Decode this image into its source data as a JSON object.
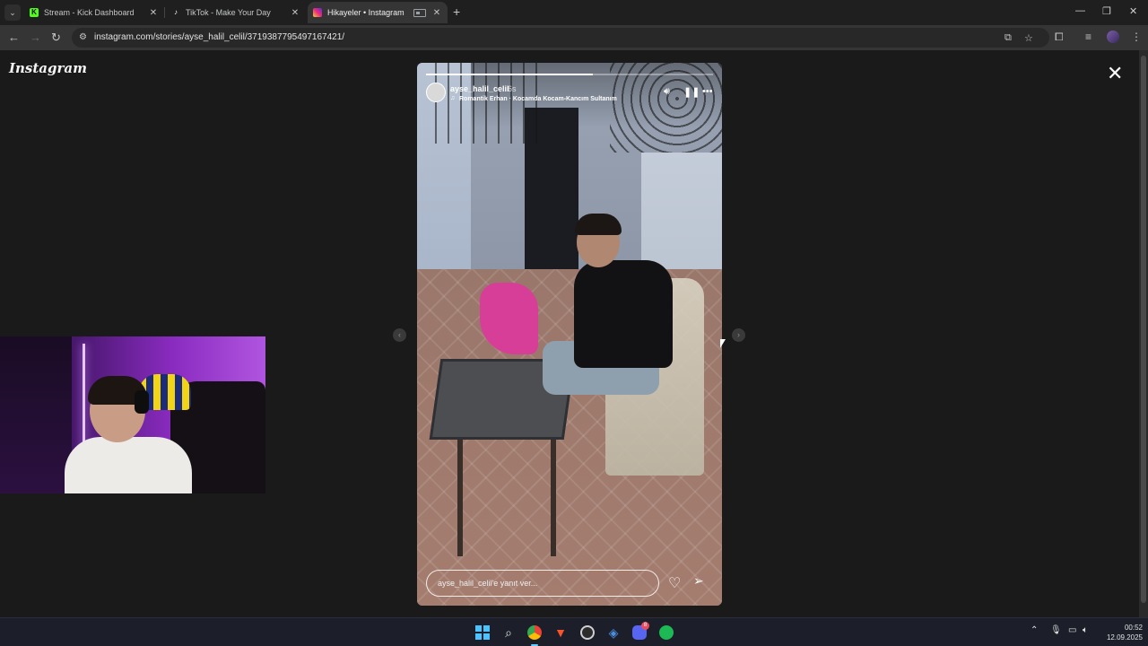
{
  "browser": {
    "tabs": [
      {
        "title": "Stream - Kick Dashboard",
        "favicon": "kick-icon",
        "favicon_color": "#53fc18",
        "active": false
      },
      {
        "title": "TikTok - Make Your Day",
        "favicon": "tiktok-icon",
        "favicon_color": "#ffffff",
        "active": false
      },
      {
        "title": "Hikayeler • Instagram",
        "favicon": "instagram-icon",
        "favicon_color": "#e1306c",
        "active": true
      }
    ],
    "url": "instagram.com/stories/ayse_halil_celil/3719387795497167421/"
  },
  "instagram": {
    "logo": "Instagram",
    "story": {
      "username": "ayse_halil_celil",
      "time": "6s",
      "music": "Romantik Erhan · Kocamda Kocam-Kancım Sultanım",
      "progress": 0.58,
      "reply_placeholder": "ayse_halil_celil'e yanıt ver..."
    }
  },
  "taskbar": {
    "apps": [
      "start-icon",
      "search-icon",
      "chrome-icon",
      "brave-icon",
      "obs-icon",
      "app-icon",
      "discord-icon",
      "spotify-icon"
    ],
    "discord_badge": "8",
    "time": "00:52",
    "date": "12.09.2025"
  },
  "colors": {
    "accent": "#60cdff",
    "instagram": "#e1306c",
    "kick": "#53fc18",
    "spotify": "#1db954"
  }
}
